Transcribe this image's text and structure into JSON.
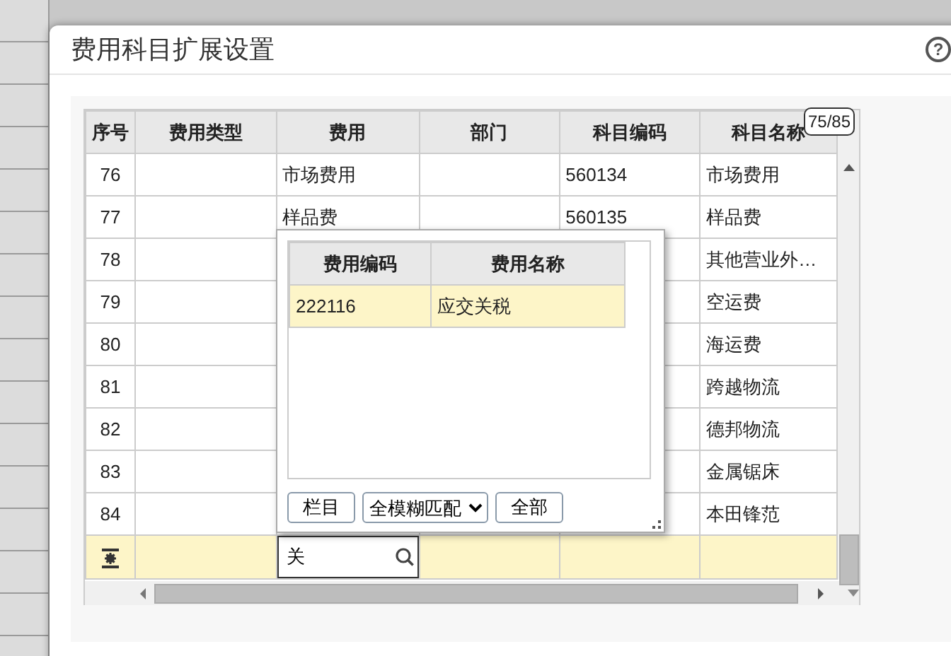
{
  "window": {
    "title": "费用科目扩展设置",
    "help": "?"
  },
  "table": {
    "columns": [
      "序号",
      "费用类型",
      "费用",
      "部门",
      "科目编码",
      "科目名称"
    ],
    "counter": "75/85",
    "rows": [
      {
        "kind": "data",
        "seq": "76",
        "fee": "市场费用",
        "code": "560134",
        "name": "市场费用"
      },
      {
        "kind": "data",
        "seq": "77",
        "fee": "样品费",
        "code": "560135",
        "name": "样品费"
      },
      {
        "kind": "data",
        "seq": "78",
        "name": "其他营业外…"
      },
      {
        "kind": "data",
        "seq": "79",
        "name": "空运费"
      },
      {
        "kind": "data",
        "seq": "80",
        "name": "海运费"
      },
      {
        "kind": "data",
        "seq": "81",
        "name": "跨越物流"
      },
      {
        "kind": "data",
        "seq": "82",
        "name": "德邦物流"
      },
      {
        "kind": "data",
        "seq": "83",
        "name": "金属锯床"
      },
      {
        "kind": "data",
        "seq": "84",
        "name": "本田锋范"
      },
      {
        "kind": "new",
        "fee_input": {
          "value": "关"
        }
      }
    ]
  },
  "lookup": {
    "columns": [
      "费用编码",
      "费用名称"
    ],
    "rows": [
      {
        "code": "222116",
        "name": "应交关税",
        "selected": true
      }
    ],
    "column_button": "栏目",
    "match_mode": "全模糊匹配",
    "all_button": "全部"
  }
}
